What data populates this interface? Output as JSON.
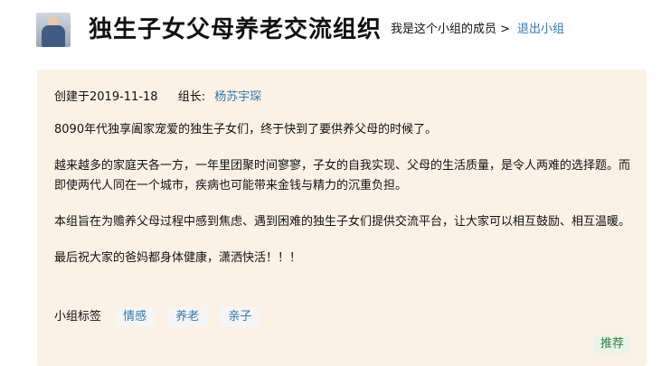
{
  "header": {
    "title": "独生子女父母养老交流组织",
    "member_link": "我是这个小组的成员 >",
    "quit_link": "退出小组"
  },
  "info": {
    "created": "创建于2019-11-18",
    "leader_label": "组长:",
    "leader_name": "杨苏宇琛"
  },
  "description": [
    "8090年代独享阖家宠爱的独生子女们，终于快到了要供养父母的时候了。",
    "越来越多的家庭天各一方，一年里团聚时间寥寥，子女的自我实现、父母的生活质量，是令人两难的选择题。而即使两代人同在一个城市，疾病也可能带来金钱与精力的沉重负担。",
    "本组旨在为赡养父母过程中感到焦虑、遇到困难的独生子女们提供交流平台，让大家可以相互鼓励、相互温暖。",
    "最后祝大家的爸妈都身体健康，潇洒快活！！！"
  ],
  "tags": {
    "label": "小组标签",
    "items": [
      "情感",
      "养老",
      "亲子"
    ]
  },
  "recommend": "推荐",
  "colors": {
    "panel_bg": "#fcf1e5",
    "link": "#3377aa",
    "recommend_bg": "#e9f4e9",
    "recommend_text": "#2f7d40"
  }
}
